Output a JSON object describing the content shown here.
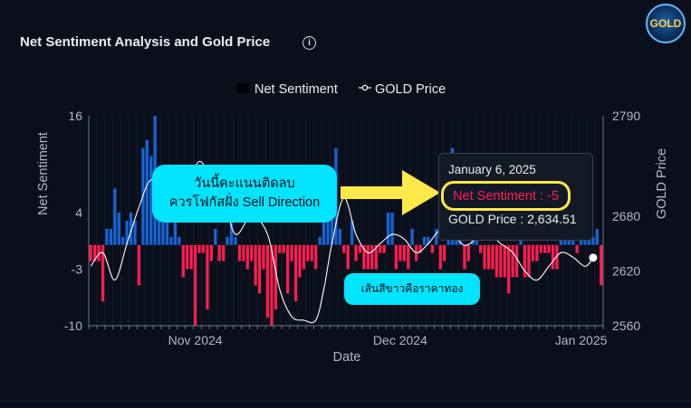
{
  "header": {
    "title": "Net Sentiment Analysis and Gold Price",
    "info_icon": "info-icon",
    "logo_text": "GOLD"
  },
  "annotations": {
    "thai_line1": "วันนี้คะแนนติดลบ",
    "thai_line2": "ควรโฟกัสฝั่ง Sell Direction",
    "white_line_note": "เส้นสีขาวคือราคาทอง"
  },
  "tooltip": {
    "date": "January 6, 2025",
    "sentiment": "Net Sentiment : -5",
    "gold": "GOLD Price : 2,634.51"
  },
  "colors": {
    "positive_bar": "#1565d8",
    "negative_bar": "#ff1e4d",
    "gold_line": "#ffffff",
    "callout": "#00e5ff",
    "arrow": "#ffe84a",
    "background": "#0b0f1c"
  },
  "chart_data": {
    "type": "bar",
    "title": "Net Sentiment Analysis and Gold Price",
    "xlabel": "Date",
    "ylabel": "Net Sentiment",
    "y2label": "GOLD Price",
    "legend": [
      "Net Sentiment",
      "GOLD Price"
    ],
    "legend_position": "top-center",
    "ylim": [
      -10,
      16
    ],
    "y2lim": [
      2560,
      2790
    ],
    "yticks": [
      16,
      4,
      -3,
      -10
    ],
    "y2ticks": [
      2790,
      2680,
      2620,
      2560
    ],
    "xtick_labels": [
      "Nov 2024",
      "Dec 2024",
      "Jan 2025"
    ],
    "xtick_index": [
      26,
      77,
      122
    ],
    "series": [
      {
        "name": "Net Sentiment",
        "kind": "bar",
        "values": [
          -2,
          -2,
          -2,
          -7,
          2,
          2,
          7,
          4,
          1,
          3,
          4,
          3,
          -5,
          12,
          13,
          11,
          16,
          8,
          4,
          3,
          1,
          3,
          1,
          -4,
          -3,
          -3,
          -10,
          -1,
          -1,
          -8,
          -2,
          2,
          -2,
          -2,
          1,
          3,
          1,
          -2,
          -2,
          -3,
          -2,
          -5,
          -6,
          -3,
          -9,
          -10,
          -8,
          -1,
          -1,
          -6,
          -2,
          -7,
          -4,
          -3,
          -2,
          -2,
          -3,
          1,
          3,
          4,
          8,
          12,
          2,
          -1,
          -3,
          3,
          -2,
          -1,
          -3,
          -3,
          -3,
          -3,
          -1,
          -1,
          4,
          4,
          -3,
          -2,
          -2,
          -3,
          2,
          -2,
          -1,
          1,
          1,
          -1,
          2,
          -3,
          -2,
          4,
          12,
          7,
          1,
          -3,
          -2,
          1,
          2,
          -1,
          -3,
          -3,
          -3,
          -4,
          -4,
          -4,
          -6,
          -4,
          -4,
          1,
          -4,
          -4,
          -2,
          -2,
          -1,
          -1,
          -1,
          -3,
          -3,
          2,
          2,
          1,
          1,
          -1,
          1,
          1,
          1,
          1,
          2,
          -5
        ],
        "color": "#1565d8"
      },
      {
        "name": "GOLD Price",
        "kind": "line",
        "x": [
          0,
          3,
          6,
          9,
          12,
          15,
          18,
          21,
          24,
          27,
          30,
          33,
          36,
          40,
          44,
          47,
          50,
          53,
          56,
          58,
          60,
          63,
          66,
          69,
          72,
          75,
          78,
          81,
          84,
          87,
          90,
          93,
          96,
          99,
          102,
          105,
          108,
          111,
          114,
          117,
          120,
          123,
          125
        ],
        "values": [
          2625,
          2640,
          2610,
          2650,
          2690,
          2720,
          2700,
          2680,
          2710,
          2740,
          2720,
          2700,
          2660,
          2680,
          2660,
          2600,
          2570,
          2566,
          2566,
          2600,
          2650,
          2700,
          2660,
          2640,
          2650,
          2660,
          2655,
          2640,
          2650,
          2665,
          2660,
          2648,
          2655,
          2660,
          2650,
          2640,
          2620,
          2610,
          2625,
          2640,
          2635,
          2625,
          2634.51
        ],
        "color": "#ffffff"
      }
    ],
    "highlight": {
      "date": "January 6, 2025",
      "sentiment": -5,
      "gold": 2634.51
    }
  }
}
